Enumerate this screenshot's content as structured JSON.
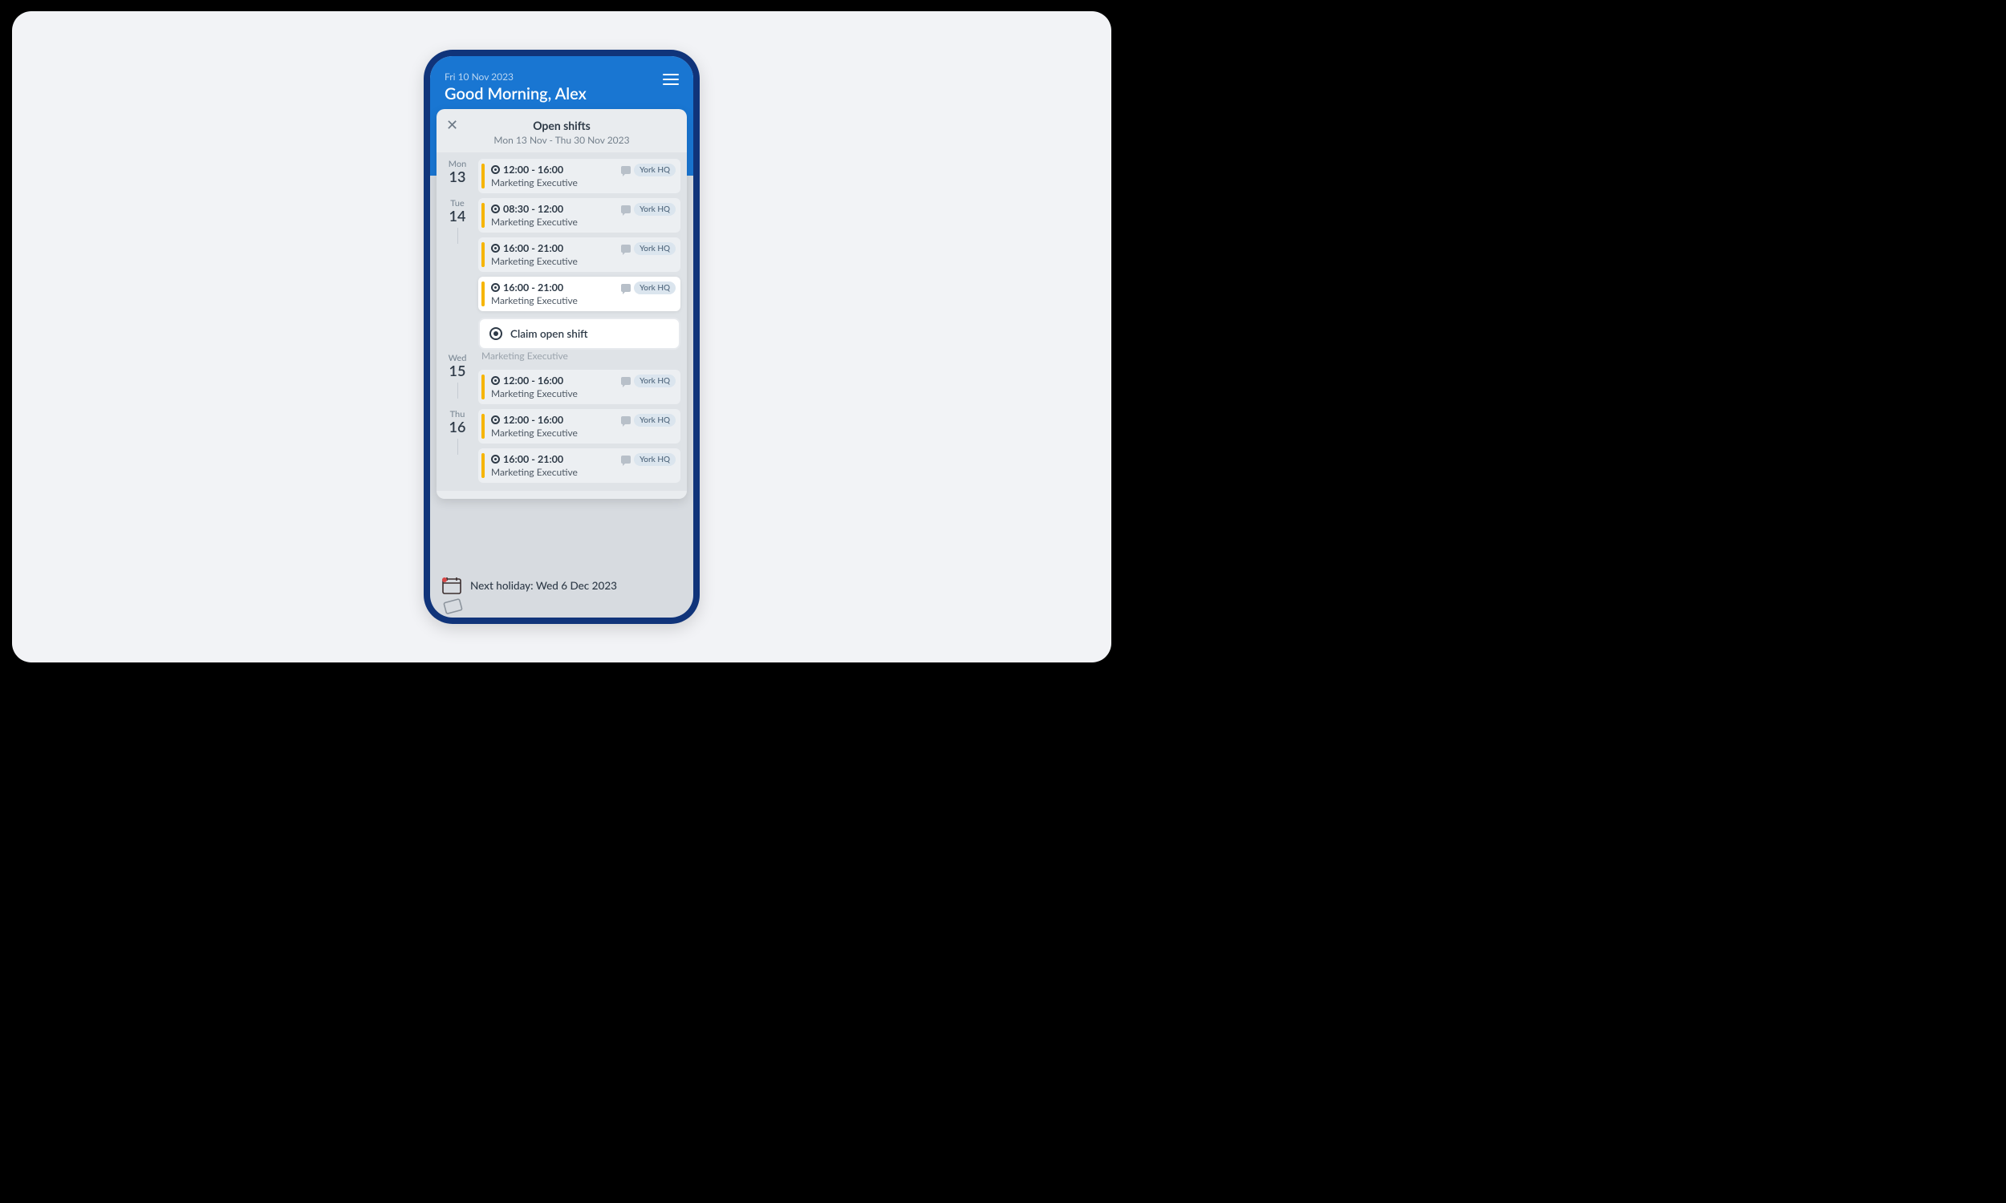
{
  "header": {
    "date": "Fri 10 Nov 2023",
    "greeting": "Good Morning, Alex"
  },
  "panel": {
    "title": "Open shifts",
    "subtitle": "Mon 13 Nov - Thu 30 Nov 2023",
    "claim_label": "Claim open shift"
  },
  "days": [
    {
      "name": "Mon",
      "num": "13",
      "shifts": [
        {
          "time": "12:00 - 16:00",
          "role": "Marketing Executive",
          "location": "York HQ",
          "active": false
        }
      ]
    },
    {
      "name": "Tue",
      "num": "14",
      "shifts": [
        {
          "time": "08:30 - 12:00",
          "role": "Marketing Executive",
          "location": "York HQ",
          "active": false
        },
        {
          "time": "16:00 - 21:00",
          "role": "Marketing Executive",
          "location": "York HQ",
          "active": false
        },
        {
          "time": "16:00 - 21:00",
          "role": "Marketing Executive",
          "location": "York HQ",
          "active": true
        }
      ]
    },
    {
      "name": "Wed",
      "num": "15",
      "peek_role": "Marketing Executive",
      "shifts": [
        {
          "time": "12:00 - 16:00",
          "role": "Marketing Executive",
          "location": "York HQ",
          "active": false
        }
      ]
    },
    {
      "name": "Thu",
      "num": "16",
      "shifts": [
        {
          "time": "12:00 - 16:00",
          "role": "Marketing Executive",
          "location": "York HQ",
          "active": false
        },
        {
          "time": "16:00 - 21:00",
          "role": "Marketing Executive",
          "location": "York HQ",
          "active": false
        }
      ]
    }
  ],
  "footer": {
    "next_holiday": "Next holiday: Wed 6 Dec 2023"
  }
}
